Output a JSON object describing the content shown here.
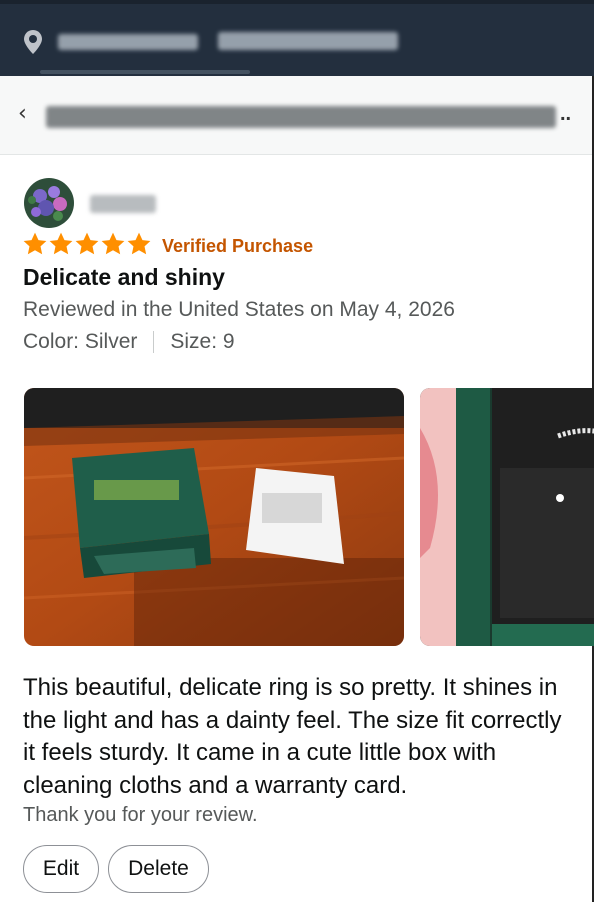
{
  "review": {
    "rating_label": "★★★★★",
    "rating": 5,
    "verified": "Verified Purchase",
    "title": "Delicate and shiny",
    "date": "Reviewed in the United States on May 4, 2026",
    "color": "Color: Silver",
    "size": "Size: 9",
    "body_lines": [
      "This beautiful, delicate ring is so pretty. It shines in",
      "the light and has a dainty feel. The size fit correctly",
      "it feels sturdy. It came in a cute little box with",
      "cleaning cloths and a warranty card."
    ],
    "thanks": "Thank you for your review."
  },
  "actions": {
    "edit": "Edit",
    "delete": "Delete"
  },
  "header": {
    "back_icon": "chevron-left-icon",
    "ellipsis": ".."
  },
  "colors": {
    "header_bg": "#232f3e",
    "star": "#ff8f00",
    "verified": "#c45500"
  }
}
